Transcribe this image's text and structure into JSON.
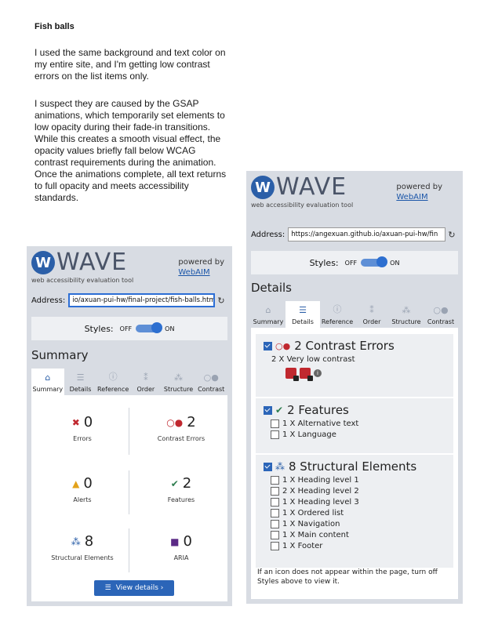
{
  "doc": {
    "title": "Fish balls",
    "para1": "I used the same background and text color on my entire site, and I'm getting low contrast errors on the list items only.",
    "para2": "I suspect they are caused by the GSAP animations, which temporarily set elements to low opacity during their fade-in transitions. While this creates a smooth visual effect, the opacity values briefly fall below WCAG contrast requirements during the animation. Once the animations complete, all text returns to full opacity and meets accessibility standards."
  },
  "wave": {
    "logo_text": "WAVE",
    "tagline": "web accessibility evaluation tool",
    "powered_by": "powered by",
    "webaim_link": "WebAIM",
    "address_label": "Address:",
    "refresh_icon": "refresh-icon",
    "styles_label": "Styles:",
    "styles_off": "OFF",
    "styles_on": "ON",
    "tabs": [
      {
        "label": "Summary",
        "icon": "home-icon"
      },
      {
        "label": "Details",
        "icon": "list-icon"
      },
      {
        "label": "Reference",
        "icon": "info-icon"
      },
      {
        "label": "Order",
        "icon": "order-icon"
      },
      {
        "label": "Structure",
        "icon": "structure-icon"
      },
      {
        "label": "Contrast",
        "icon": "contrast-icon"
      }
    ]
  },
  "left_panel": {
    "address_value": "io/axuan-pui-hw/final-project/fish-balls.html",
    "section_title": "Summary",
    "summary": {
      "errors": {
        "value": "0",
        "label": "Errors"
      },
      "contrast_errors": {
        "value": "2",
        "label": "Contrast Errors"
      },
      "alerts": {
        "value": "0",
        "label": "Alerts"
      },
      "features": {
        "value": "2",
        "label": "Features"
      },
      "structural": {
        "value": "8",
        "label": "Structural Elements"
      },
      "aria": {
        "value": "0",
        "label": "ARIA"
      }
    },
    "view_details_label": "View details ›"
  },
  "right_panel": {
    "address_value": "https://angexuan.github.io/axuan-pui-hw/fin",
    "section_title": "Details",
    "contrast": {
      "heading": "2 Contrast Errors",
      "item": "2 X Very low contrast"
    },
    "features": {
      "heading": "2 Features",
      "items": [
        "1 X Alternative text",
        "1 X Language"
      ]
    },
    "structural": {
      "heading": "8 Structural Elements",
      "items": [
        "1 X Heading level 1",
        "2 X Heading level 2",
        "1 X Heading level 3",
        "1 X Ordered list",
        "1 X Navigation",
        "1 X Main content",
        "1 X Footer"
      ]
    },
    "footnote": "If an icon does not appear within the page, turn off Styles above to view it."
  },
  "colors": {
    "panel_bg": "#d8dce3",
    "accent_blue": "#2b65b8",
    "error_red": "#c0282f",
    "alert_orange": "#e3a21a",
    "feature_green": "#2e7d4f",
    "aria_purple": "#5b2a86"
  }
}
